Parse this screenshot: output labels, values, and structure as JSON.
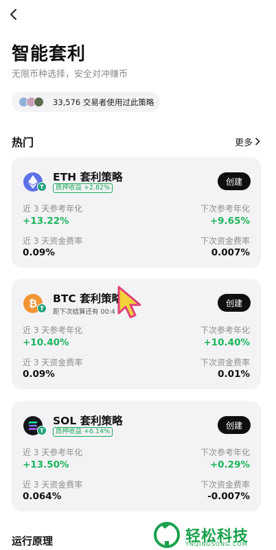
{
  "header": {
    "title": "智能套利",
    "subtitle": "无限币种选择，安全对冲赚币"
  },
  "users": {
    "text": "33,576 交易者使用过此策略"
  },
  "hot": {
    "title": "热门",
    "more": "更多"
  },
  "cards": [
    {
      "name": "ETH 套利策略",
      "tag": "质押收益 +2.82%",
      "create": "创建",
      "left_label_1": "近 3 天参考年化",
      "left_value_1": "+13.22%",
      "right_label_1": "下次参考年化",
      "right_value_1": "+9.65%",
      "left_label_2": "近 3 天资金费率",
      "left_value_2": "0.09%",
      "right_label_2": "下次资金费率",
      "right_value_2": "0.007%"
    },
    {
      "name": "BTC 套利策略",
      "note": "距下次结算还有 00:4",
      "create": "创建",
      "left_label_1": "近 3 天参考年化",
      "left_value_1": "+10.40%",
      "right_label_1": "下次参考年化",
      "right_value_1": "+10.40%",
      "left_label_2": "近 3 天资金费率",
      "left_value_2": "0.09%",
      "right_label_2": "下次资金费率",
      "right_value_2": "0.01%"
    },
    {
      "name": "SOL 套利策略",
      "tag": "质押收益 +6.14%",
      "create": "创建",
      "left_label_1": "近 3 天参考年化",
      "left_value_1": "+13.50%",
      "right_label_1": "下次参考年化",
      "right_value_1": "+0.29%",
      "left_label_2": "近 3 天资金费率",
      "left_value_2": "0.064%",
      "right_label_2": "下次资金费率",
      "right_value_2": "-0.007%"
    }
  ],
  "bottom": {
    "title": "运行原理"
  },
  "watermark": {
    "text": "轻松科技",
    "sub": "YNQINGSONG.COM"
  },
  "colors": {
    "green": "#1cb55c",
    "card_bg": "#f3f3f5",
    "button": "#0f0f10"
  },
  "icons": {
    "back": "chevron-left-icon",
    "more": "chevron-right-icon"
  }
}
